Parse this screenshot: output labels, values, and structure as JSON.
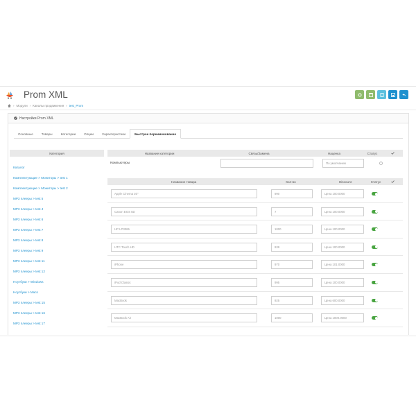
{
  "header": {
    "title": "Prom XML",
    "breadcrumb": [
      "Модули",
      "Каналы продвижения",
      "test_Prom"
    ]
  },
  "toolbar": {
    "buttons": [
      "save-stay",
      "save",
      "copy",
      "save-close",
      "back"
    ]
  },
  "panel": {
    "heading": "Настройки Prom XML"
  },
  "tabs": [
    "Основные",
    "Товары",
    "Категории",
    "Опции",
    "Характеристики",
    "Быстрое переименование"
  ],
  "active_tab": "Быстрое переименование",
  "categories": {
    "header": "Категория",
    "items": [
      "Каталог",
      "Комплектующие  >  Мониторы  >  test 1",
      "Комплектующие  >  Мониторы  >  test 2",
      "MP3 плееры  >  test 5",
      "MP3 плееры  >  test 4",
      "MP3 плееры  >  test 6",
      "MP3 плееры  >  test 7",
      "MP3 плееры  >  test 8",
      "MP3 плееры  >  test 9",
      "MP3 плееры  >  test 11",
      "MP3 плееры  >  test 12",
      "Ноутбуки  >  Windows",
      "Ноутбуки  >  Macs",
      "MP3 плееры  >  test 15",
      "MP3 плееры  >  test 16",
      "MP3 плееры  >  test 17"
    ]
  },
  "category_table": {
    "headers": [
      "Название категории",
      "Связь/Замена",
      "Наценка",
      "Статус"
    ],
    "check_icon": "check-icon",
    "row": {
      "name": "Компьютеры",
      "link_value": "",
      "markup_placeholder": "По умолчанию"
    }
  },
  "products_table": {
    "headers": [
      "Название товара",
      "Кол-во",
      "Discount",
      "Статус"
    ],
    "rows": [
      {
        "name": "Apple Cinema 30\"",
        "qty": "990",
        "discount": "Цена 100.0000"
      },
      {
        "name": "Canon EOS 5D",
        "qty": "7",
        "discount": "Цена 100.0000"
      },
      {
        "name": "HP LP3065",
        "qty": "1000",
        "discount": "Цена 100.0000"
      },
      {
        "name": "HTC Touch HD",
        "qty": "939",
        "discount": "Цена 100.0000"
      },
      {
        "name": "iPhone",
        "qty": "970",
        "discount": "Цена 101.0000"
      },
      {
        "name": "iPod Classic",
        "qty": "995",
        "discount": "Цена 100.0000"
      },
      {
        "name": "MacBook",
        "qty": "925",
        "discount": "Цена 600.0000"
      },
      {
        "name": "MacBook Air",
        "qty": "1000",
        "discount": "Цена 1000.0000"
      }
    ]
  },
  "colors": {
    "accent": "#1e91cf",
    "green": "#8fbb6c",
    "teal": "#5bc0de",
    "toggle_on": "#4aa542"
  }
}
